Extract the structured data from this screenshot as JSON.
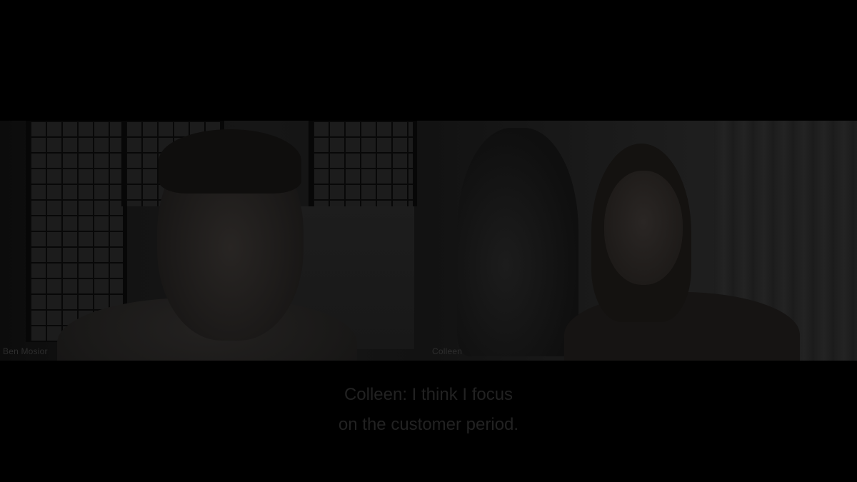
{
  "participants": [
    {
      "name": "Ben Mosior"
    },
    {
      "name": "Colleen"
    }
  ],
  "captions": {
    "line1": "Colleen: I think I focus",
    "line2": "on the customer period."
  },
  "colors": {
    "background": "#000000",
    "caption_text": "#222222",
    "name_label": "#2e2e2e"
  }
}
